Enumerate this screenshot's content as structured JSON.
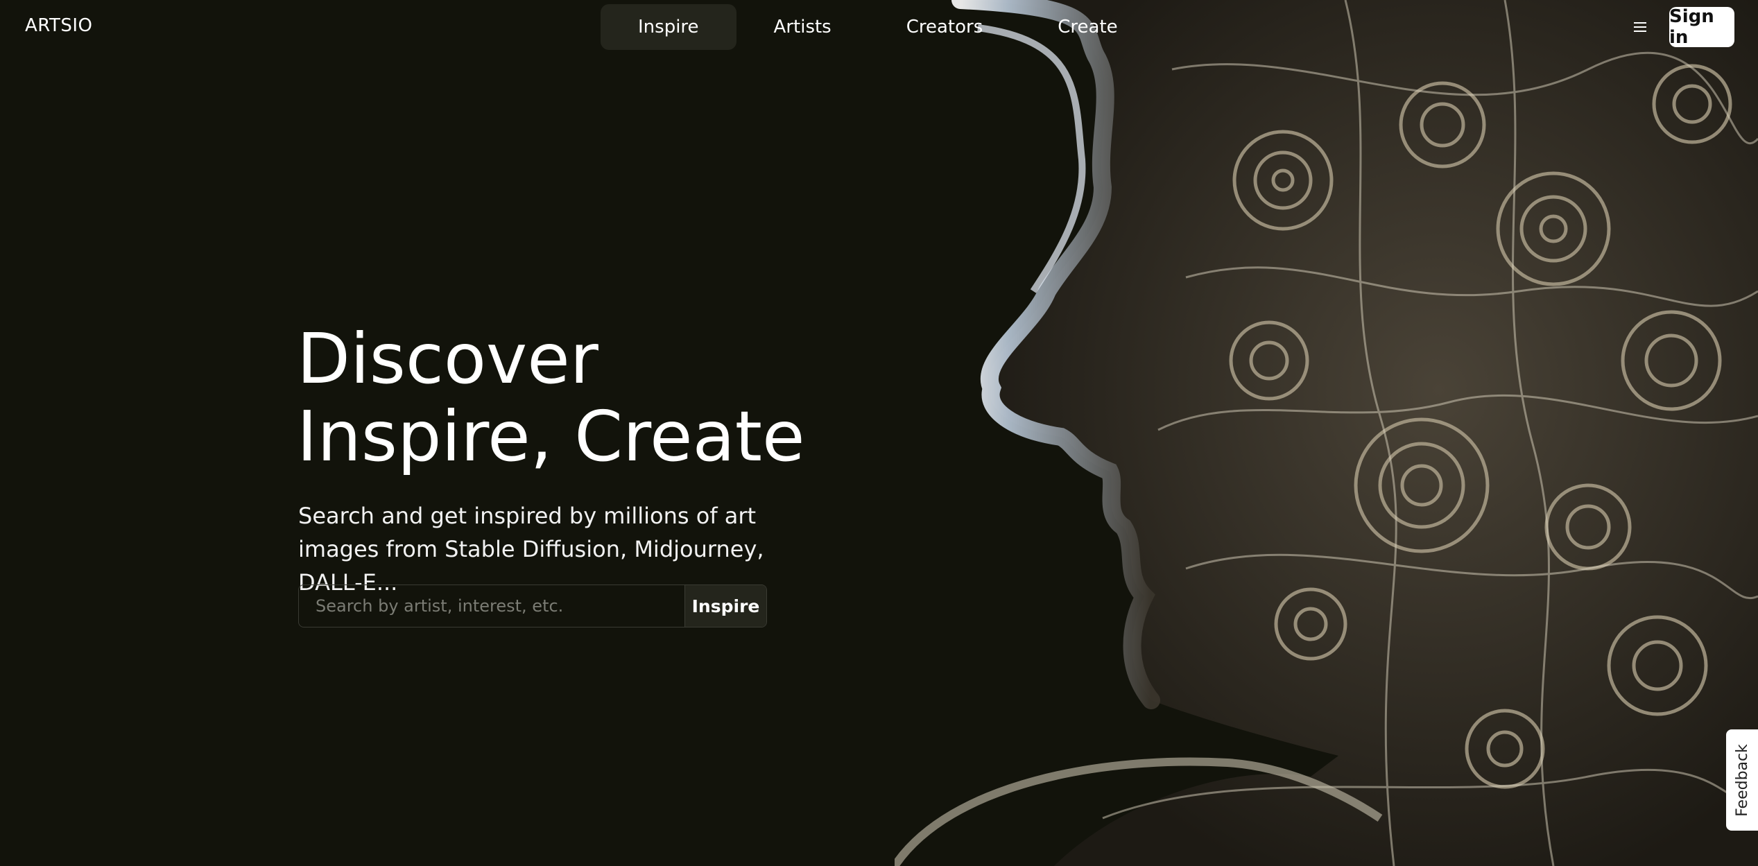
{
  "brand": {
    "logo": "ARTSIO"
  },
  "nav": {
    "items": [
      {
        "label": "Inspire"
      },
      {
        "label": "Artists"
      },
      {
        "label": "Creators"
      },
      {
        "label": "Create"
      }
    ],
    "active_index": 0,
    "menu_icon": "hamburger-menu-icon",
    "signin_label": "Sign in"
  },
  "hero": {
    "headline_line1": "Discover",
    "headline_line2": "Inspire, Create",
    "subtext": "Search and get inspired by millions of art images from Stable Diffusion, Midjourney, DALL-E...",
    "search_placeholder": "Search by artist, interest, etc.",
    "search_value": "",
    "search_button": "Inspire"
  },
  "feedback": {
    "label": "Feedback"
  },
  "colors": {
    "background": "#12130b",
    "active_nav": "#24251c",
    "signin_bg": "#ffffff"
  }
}
